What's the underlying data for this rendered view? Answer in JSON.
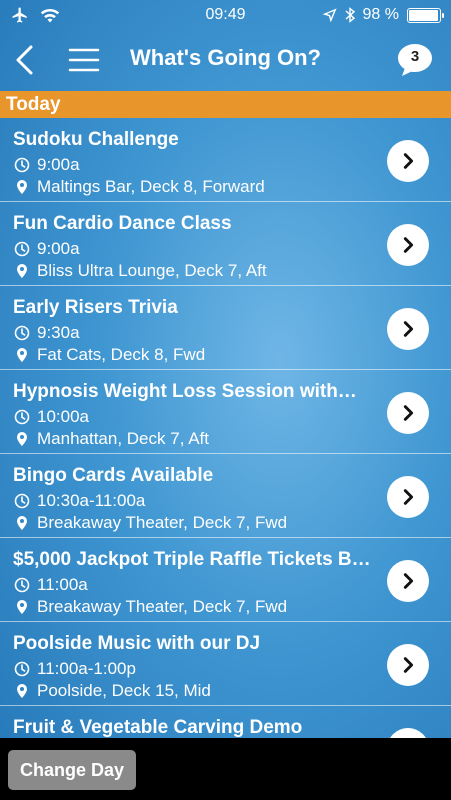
{
  "status_bar": {
    "time": "09:49",
    "battery_text": "98 %",
    "battery_level": 0.98,
    "icons": [
      "airplane-icon",
      "wifi-icon",
      "location-arrow-icon",
      "bluetooth-icon",
      "battery-icon"
    ]
  },
  "nav": {
    "title": "What's Going On?",
    "chat_count": "3",
    "icons": [
      "back-chevron-icon",
      "hamburger-menu-icon",
      "chat-bubble-icon"
    ]
  },
  "section": {
    "label": "Today",
    "color": "#e8962c"
  },
  "events": [
    {
      "title": "Sudoku Challenge",
      "time": "9:00a",
      "location": "Maltings Bar, Deck 8, Forward"
    },
    {
      "title": "Fun Cardio Dance Class",
      "time": "9:00a",
      "location": "Bliss Ultra Lounge, Deck 7, Aft"
    },
    {
      "title": "Early Risers Trivia",
      "time": "9:30a",
      "location": "Fat Cats, Deck 8, Fwd"
    },
    {
      "title": "Hypnosis Weight Loss Session with…",
      "time": "10:00a",
      "location": "Manhattan, Deck 7, Aft"
    },
    {
      "title": "Bingo Cards Available",
      "time": "10:30a-11:00a",
      "location": "Breakaway Theater, Deck 7, Fwd"
    },
    {
      "title": "$5,000 Jackpot Triple Raffle Tickets B…",
      "time": "11:00a",
      "location": "Breakaway Theater, Deck 7, Fwd"
    },
    {
      "title": "Poolside Music with our DJ",
      "time": "11:00a-1:00p",
      "location": "Poolside, Deck 15, Mid"
    },
    {
      "title": "Fruit & Vegetable Carving Demo",
      "time": "",
      "location": ""
    }
  ],
  "bottom": {
    "change_day_label": "Change Day"
  }
}
